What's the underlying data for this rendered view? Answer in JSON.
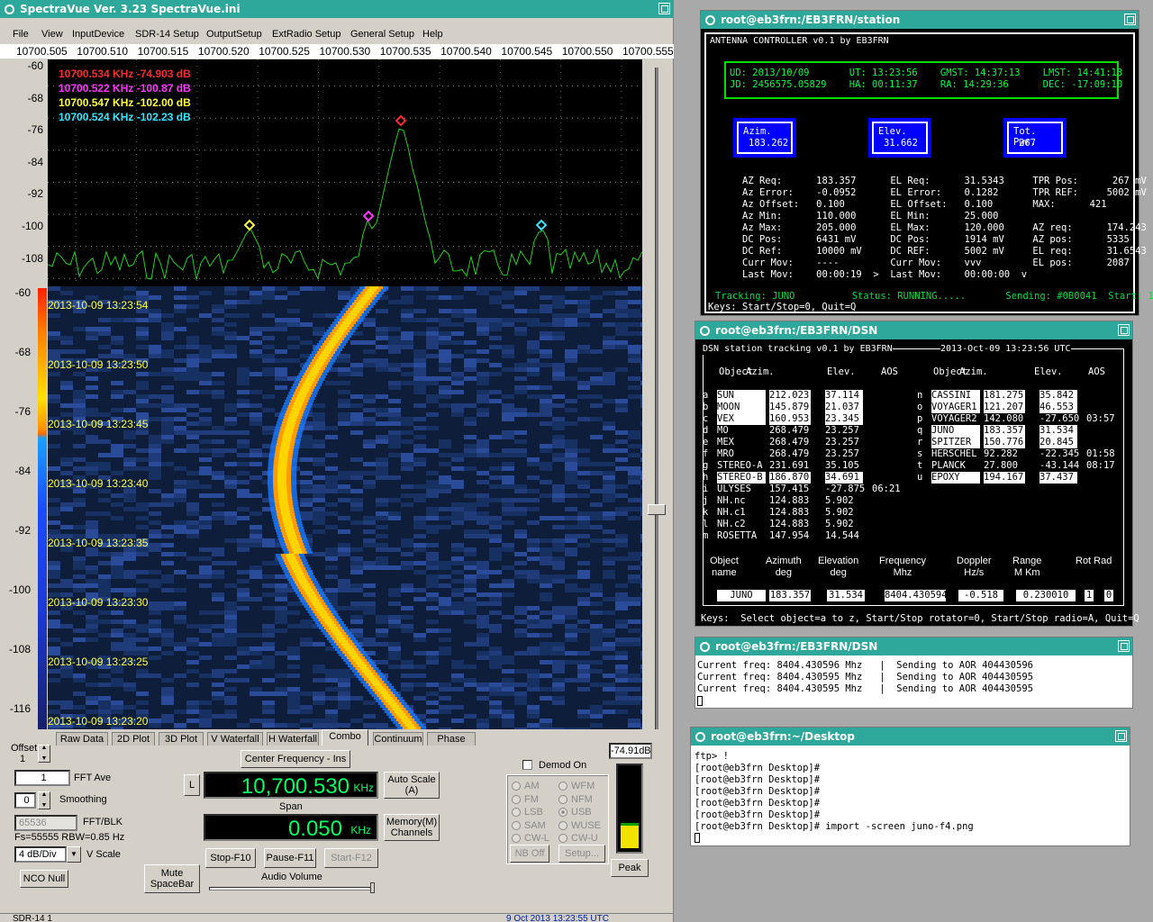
{
  "sv": {
    "title": "SpectraVue Ver. 3.23  SpectraVue.ini",
    "menu": [
      "File",
      "View",
      "InputDevice",
      "SDR-14 Setup",
      "OutputSetup",
      "ExtRadio Setup",
      "General Setup",
      "Help"
    ],
    "freq_labels": [
      "10700.505",
      "10700.510",
      "10700.515",
      "10700.520",
      "10700.525",
      "10700.530",
      "10700.535",
      "10700.540",
      "10700.545",
      "10700.550",
      "10700.555"
    ],
    "db_labels": [
      "-60",
      "-68",
      "-76",
      "-84",
      "-92",
      "-100",
      "-108"
    ],
    "wf_labels": [
      "-60",
      "-68",
      "-76",
      "-84",
      "-92",
      "-100",
      "-108",
      "-116"
    ],
    "markers": [
      {
        "text": "10700.534 KHz  -74.903 dB",
        "color": "#ff2a2a"
      },
      {
        "text": "10700.522 KHz  -100.87 dB",
        "color": "#ff33ff"
      },
      {
        "text": "10700.547 KHz  -102.00 dB",
        "color": "#ffff33"
      },
      {
        "text": "10700.524 KHz  -102.23 dB",
        "color": "#33e6ff"
      }
    ],
    "timestamps": [
      "2013-10-09 13:23:54",
      "2013-10-09 13:23:50",
      "2013-10-09 13:23:45",
      "2013-10-09 13:23:40",
      "2013-10-09 13:23:35",
      "2013-10-09 13:23:30",
      "2013-10-09 13:23:25",
      "2013-10-09 13:23:20"
    ],
    "tabs": [
      "Raw Data",
      "2D Plot",
      "3D Plot",
      "V Waterfall",
      "H Waterfall",
      "Combo",
      "Continuum",
      "Phase"
    ],
    "offset_label": "Offset",
    "offset_value": "1",
    "fft_ave_value": "1",
    "fft_ave_label": "FFT Ave",
    "smoothing_value": "0",
    "smoothing_label": "Smoothing",
    "fft_blk_value": "65536",
    "fft_blk_label": "FFT/BLK",
    "fs_text": "Fs=55555 RBW=0.85 Hz",
    "vscale_value": "4 dB/Div",
    "vscale_label": "V Scale",
    "nco_null": "NCO Null",
    "mute": "Mute\nSpaceBar",
    "center_freq_label": "Center Frequency - Ins",
    "l_button": "L",
    "center_freq": "10,700.530",
    "center_unit": "KHz",
    "span_label": "Span",
    "span": "0.050",
    "span_unit": "KHz",
    "auto_scale": "Auto Scale\n(A)",
    "memory": "Memory(M)\nChannels",
    "stop": "Stop-F10",
    "pause": "Pause-F11",
    "start": "Start-F12",
    "audio_volume": "Audio Volume",
    "demod_on": "Demod On",
    "radios_left": [
      "AM",
      "FM",
      "LSB",
      "SAM",
      "CW-L"
    ],
    "radios_right": [
      "WFM",
      "NFM",
      "USB",
      "WUSE",
      "CW-U"
    ],
    "nb_off": "NB Off",
    "setup": "Setup...",
    "peak_value": "-74.91dB",
    "peak_level": 0.3,
    "peak_button": "Peak",
    "status_left": "SDR-14 1",
    "status_right": "9 Oct 2013  13:23:55 UTC"
  },
  "station": {
    "title": "root@eb3frn:/EB3FRN/station",
    "lines": [
      "ANTENNA CONTROLLER v0.1 by EB3FRN",
      "UD: 2013/10/09       UT: 13:23:56    GMST: 14:37:13    LMST: 14:41:13",
      "JD: 2456575.05829    HA: 00:11:37    RA: 14:29:36      DEC: -17:09:10",
      "AZ Req:      183.357      EL Req:      31.5343     TPR Pos:      267 mV",
      "Az Error:    -0.0952      EL Error:    0.1282      TPR REF:     5002 mV",
      "Az Offset:   0.100        EL Offset:   0.100       MAX:      421",
      "Az Min:      110.000      EL Min:      25.000",
      "Az Max:      205.000      EL Max:      120.000     AZ req:      174.243",
      "DC Pos:      6431 mV      DC Pos:      1914 mV     AZ pos:      5335",
      "DC Ref:      10000 mV     DC REF:      5002 mV     EL req:      31.6543",
      "Curr Mov:    ----         Curr Mov:    vvv         EL pos:      2087",
      "Last Mov:    00:00:19  >  Last Mov:    00:00:00  v",
      "Tracking: JUNO          Status: RUNNING.....       Sending: #0B0041  Start: 1",
      "Keys: Start/Stop=0, Quit=Q"
    ],
    "boxes": [
      {
        "label": "Azim.",
        "value": "183.262"
      },
      {
        "label": "Elev.",
        "value": "31.662"
      },
      {
        "label": "Tot. Pwr.",
        "value": "267"
      }
    ]
  },
  "dsn": {
    "title": "root@eb3frn:/EB3FRN/DSN",
    "header_left": "DSN station tracking v0.1 by EB3FRN",
    "header_right": "2013-Oct-09 13:23:56 UTC",
    "cols": [
      "Object",
      "Azim.",
      "Elev.",
      "AOS",
      "Object",
      "Azim.",
      "Elev.",
      "AOS"
    ],
    "left_rows": [
      [
        "a",
        "SUN",
        "212.023",
        "37.114",
        ""
      ],
      [
        "b",
        "MOON",
        "145.879",
        "21.037",
        ""
      ],
      [
        "c",
        "VEX",
        "160.953",
        "23.345",
        ""
      ],
      [
        "d",
        "MO",
        "268.479",
        "23.257",
        ""
      ],
      [
        "e",
        "MEX",
        "268.479",
        "23.257",
        ""
      ],
      [
        "f",
        "MRO",
        "268.479",
        "23.257",
        ""
      ],
      [
        "g",
        "STEREO-A",
        "231.691",
        "35.105",
        ""
      ],
      [
        "h",
        "STEREO-B",
        "186.870",
        "34.691",
        ""
      ],
      [
        "i",
        "ULYSES",
        "157.415",
        "-27.875",
        "06:21"
      ],
      [
        "j",
        "NH.nc",
        "124.883",
        "5.902",
        ""
      ],
      [
        "k",
        "NH.c1",
        "124.883",
        "5.902",
        ""
      ],
      [
        "l",
        "NH.c2",
        "124.883",
        "5.902",
        ""
      ],
      [
        "m",
        "ROSETTA",
        "147.954",
        "14.544",
        ""
      ]
    ],
    "right_rows": [
      [
        "n",
        "CASSINI",
        "181.275",
        "35.842",
        ""
      ],
      [
        "o",
        "VOYAGER1",
        "121.207",
        "46.553",
        ""
      ],
      [
        "p",
        "VOYAGER2",
        "142.080",
        "-27.650",
        "03:57"
      ],
      [
        "q",
        "JUNO",
        "183.357",
        "31.534",
        ""
      ],
      [
        "r",
        "SPITZER",
        "150.776",
        "20.845",
        ""
      ],
      [
        "s",
        "HERSCHEL",
        "92.282",
        "-22.345",
        "01:58"
      ],
      [
        "t",
        "PLANCK",
        "27.800",
        "-43.144",
        "08:17"
      ],
      [
        "u",
        "EPOXY",
        "194.167",
        "37.437",
        ""
      ]
    ],
    "bottom_heads": [
      "Object\nname",
      "Azimuth\ndeg",
      "Elevation\ndeg",
      "Frequency\nMhz",
      "Doppler\nHz/s",
      "Range\nM Km",
      "Rot Rad"
    ],
    "bottom_vals": [
      "JUNO",
      "183.357",
      "31.534",
      "8404.430594",
      "-0.518",
      "0.230010",
      "1",
      "0"
    ],
    "keys": "Keys:  Select object=a to z, Start/Stop rotator=0, Start/Stop radio=A, Quit=Q"
  },
  "dsn2": {
    "title": "root@eb3frn:/EB3FRN/DSN",
    "lines": [
      "Current freq: 8404.430596 Mhz   |  Sending to AOR 404430596",
      "Current freq: 8404.430595 Mhz   |  Sending to AOR 404430595",
      "Current freq: 8404.430595 Mhz   |  Sending to AOR 404430595"
    ]
  },
  "desk": {
    "title": "root@eb3frn:~/Desktop",
    "lines": [
      "ftp> !",
      "[root@eb3frn Desktop]#",
      "[root@eb3frn Desktop]#",
      "[root@eb3frn Desktop]#",
      "[root@eb3frn Desktop]#",
      "[root@eb3frn Desktop]#",
      "[root@eb3frn Desktop]# import -screen juno-f4.png"
    ]
  }
}
